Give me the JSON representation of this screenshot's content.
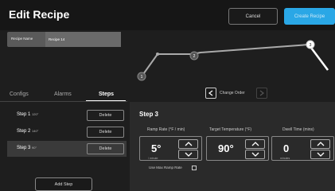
{
  "header": {
    "title": "Edit Recipe",
    "cancel_label": "Cancel",
    "create_label": "Create Recipe"
  },
  "recipe": {
    "name_label": "Recipe Name",
    "name_value": "Recipe 14"
  },
  "graph": {
    "points": [
      {
        "label": "1",
        "highlighted": false
      },
      {
        "label": "2",
        "highlighted": false
      },
      {
        "label": "3",
        "highlighted": true
      }
    ]
  },
  "tabs": {
    "configs": "Configs",
    "alarms": "Alarms",
    "steps": "Steps",
    "active": "steps"
  },
  "order": {
    "label": "Change Order"
  },
  "steps": [
    {
      "name": "Step 1",
      "temp": "120°",
      "delete_label": "Delete",
      "selected": false
    },
    {
      "name": "Step 2",
      "temp": "140°",
      "delete_label": "Delete",
      "selected": false
    },
    {
      "name": "Step 3",
      "temp": "90°",
      "delete_label": "Delete",
      "selected": true
    }
  ],
  "add_step_label": "Add Step",
  "detail": {
    "title": "Step 3",
    "ramp_label": "Ramp Rate (°F / min)",
    "ramp_value": "5°",
    "ramp_sub": "/ minute",
    "target_label": "Target Temperature (°F)",
    "target_value": "90°",
    "dwell_label": "Dwell Time (mins)",
    "dwell_value": "0",
    "dwell_sub": "minutes",
    "max_ramp_label": "Use Max Ramp Rate"
  }
}
